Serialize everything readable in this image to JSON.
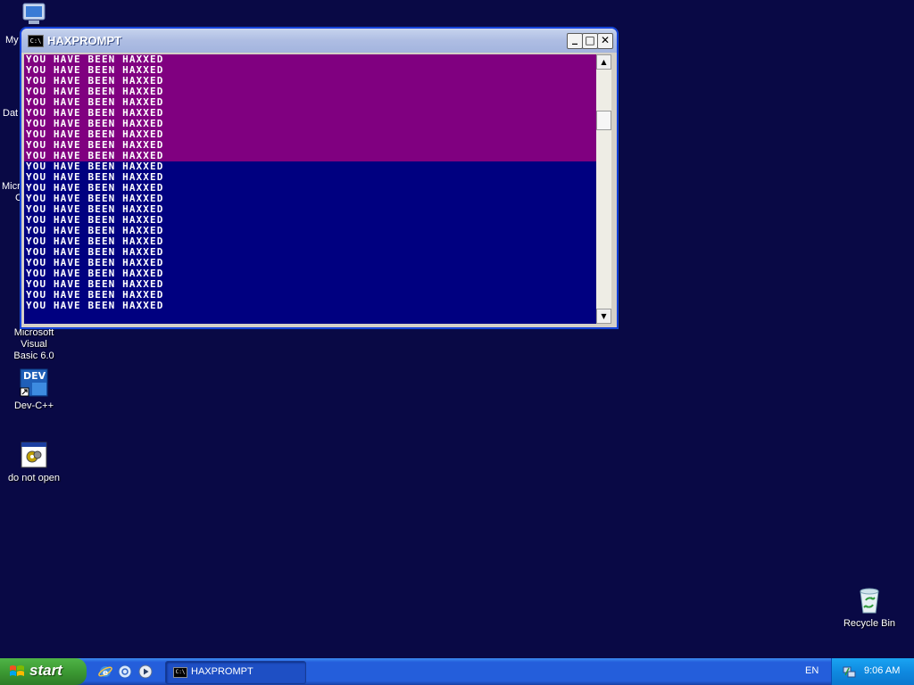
{
  "desktop": {
    "partial_labels": {
      "my": "My",
      "dat": "Dat",
      "micro": "Micro",
      "c": "C"
    },
    "icons": {
      "vb6": {
        "label_line1": "Microsoft Visual",
        "label_line2": "Basic 6.0"
      },
      "devcpp": {
        "label": "Dev-C++",
        "glyph_text": "DEV"
      },
      "donotopen": {
        "label": "do not open"
      },
      "recycle": {
        "label": "Recycle Bin"
      }
    }
  },
  "console_window": {
    "title": "HAXPROMPT",
    "icon_text": "C:\\",
    "buttons": {
      "minimize": "_",
      "maximize": "□",
      "close": "✕"
    },
    "line_text": "YOU HAVE BEEN HAXXED",
    "magenta_line_count": 10,
    "navy_line_count": 14,
    "colors": {
      "magenta": "#800080",
      "navy": "#000080",
      "text": "#ffffff"
    }
  },
  "taskbar": {
    "start_label": "start",
    "task_label": "HAXPROMPT",
    "task_icon_text": "C:\\",
    "language": "EN",
    "clock": "9:06 AM",
    "colors": {
      "bar": "#245edb",
      "start": "#3c9a33",
      "tray": "#0f8ae0"
    }
  }
}
